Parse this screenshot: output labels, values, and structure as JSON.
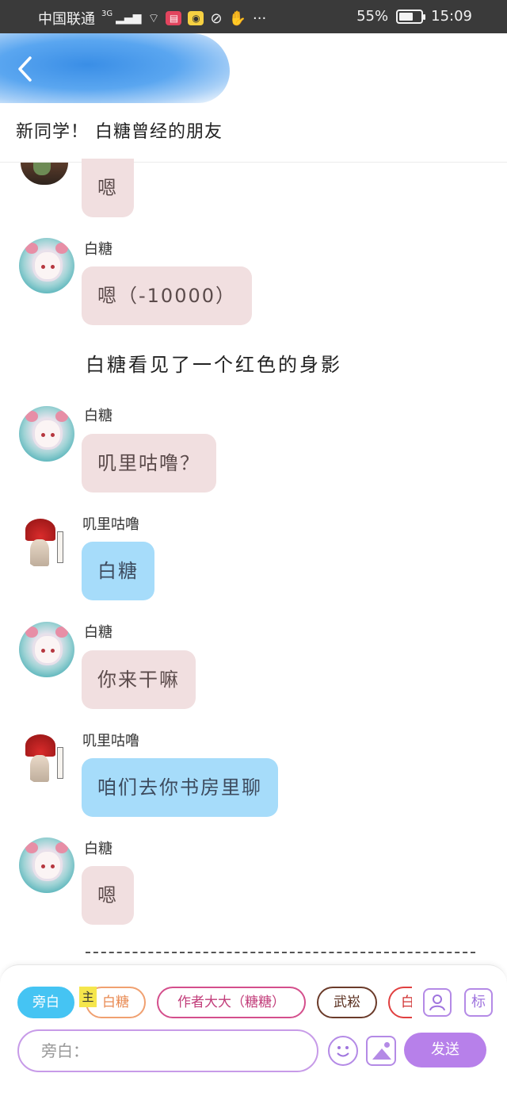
{
  "status_bar": {
    "carrier": "中国联通",
    "network": "3G",
    "battery_text": "55%",
    "time": "15:09",
    "more": "···"
  },
  "header": {
    "back_icon": "chevron-left-icon",
    "title": "新同学！ 白糖曾经的朋友"
  },
  "messages": [
    {
      "type": "partial",
      "sender": "",
      "text": "嗯",
      "style": "pink"
    },
    {
      "type": "message",
      "sender": "白糖",
      "text": "嗯（-10000）",
      "style": "pink"
    },
    {
      "type": "narration",
      "text": "白糖看见了一个红色的身影"
    },
    {
      "type": "message",
      "sender": "白糖",
      "text": "叽里咕噜？",
      "style": "pink"
    },
    {
      "type": "message",
      "sender": "叽里咕噜",
      "text": "白糖",
      "style": "blue"
    },
    {
      "type": "message",
      "sender": "白糖",
      "text": "你来干嘛",
      "style": "pink"
    },
    {
      "type": "message",
      "sender": "叽里咕噜",
      "text": "咱们去你书房里聊",
      "style": "blue"
    },
    {
      "type": "message",
      "sender": "白糖",
      "text": "嗯",
      "style": "pink"
    }
  ],
  "composer": {
    "chips": [
      {
        "label": "旁白",
        "active": true,
        "color": "#45c4f3"
      },
      {
        "label": "白糖",
        "active": false,
        "color": "#f0a070"
      },
      {
        "label": "作者大大（糖糖）",
        "active": false,
        "color": "#d44f8c"
      },
      {
        "label": "武崧",
        "active": false,
        "color": "#6b3b2a"
      },
      {
        "label": "白",
        "active": false,
        "color": "#e04040"
      }
    ],
    "main_badge": "主",
    "role_button_icon": "user-card-icon",
    "tag_button": "标",
    "input_placeholder": "旁白：",
    "emoji_icon": "smiley-icon",
    "image_icon": "image-icon",
    "send_label": "发送"
  },
  "colors": {
    "accent": "#b780ea",
    "pink_bubble": "#f1dfe0",
    "blue_bubble": "#a6dcfa",
    "narration_chip": "#45c4f3"
  }
}
